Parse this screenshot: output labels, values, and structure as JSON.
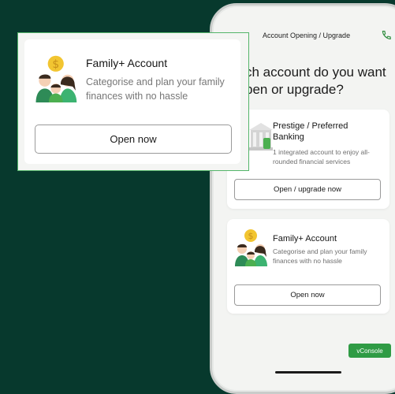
{
  "header": {
    "title": "Account Opening / Upgrade"
  },
  "question": {
    "line1": "ch account do you want",
    "line2": "pen or upgrade?"
  },
  "cards": [
    {
      "title_line1": "Prestige / Preferred",
      "title_line2": "Banking",
      "desc_line1": "1 integrated account to enjoy all-",
      "desc_line2": "rounded financial services",
      "button": "Open / upgrade now"
    },
    {
      "title_line1": "Family+ Account",
      "desc_line1": "Categorise and plan your family",
      "desc_line2": "finances with no hassle",
      "button": "Open now"
    }
  ],
  "popup": {
    "title": "Family+ Account",
    "desc_line1": "Categorise and plan your family",
    "desc_line2": "finances with no hassle",
    "button": "Open now"
  },
  "vconsole": "vConsole",
  "icons": {
    "menu": "menu-icon",
    "call": "phone-icon",
    "bank": "building-icon",
    "family": "family-money-icon"
  },
  "colors": {
    "background": "#07392d",
    "accent": "#2f9b45",
    "popup_border": "#54b56a"
  }
}
